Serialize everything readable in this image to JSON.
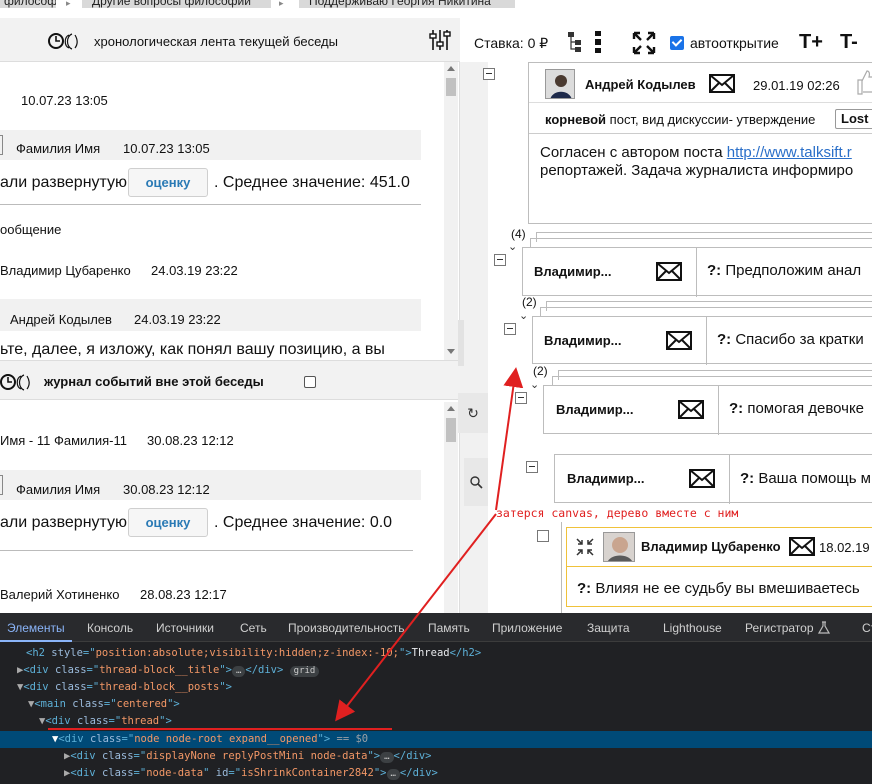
{
  "top_tabs": [
    "философии",
    "Другие вопросы философии",
    "Поддерживаю Георгия Никитина"
  ],
  "left": {
    "header_title": "хронологическая лента текущей беседы",
    "feed1": [
      {
        "date": "10.07.23 13:05"
      },
      {
        "author": "Фамилия Имя",
        "date": "10.07.23 13:05"
      },
      {
        "text_before": "али развернутую",
        "button": "оценку",
        "text_after": ". Среднее значение: 451.0"
      },
      {
        "text": "ообщение"
      },
      {
        "author": "Владимир Цубаренко",
        "date": "24.03.19 23:22"
      },
      {
        "author": "Андрей Кодылев",
        "date": "24.03.19 23:22"
      },
      {
        "text": "ьте, далее, я изложу, как понял вашу позицию, а вы"
      }
    ],
    "journal_title": "журнал событий вне этой беседы",
    "journal_checked": false,
    "feed2": [
      {
        "author": "Имя - 11 Фамилия-11",
        "date": "30.08.23 12:12"
      },
      {
        "author": "Фамилия Имя",
        "date": "30.08.23 12:12"
      },
      {
        "text_before": "али развернутую",
        "button": "оценку",
        "text_after": ". Среднее значение: 0.0"
      },
      {
        "author": "Валерий Хотиненко",
        "date": "28.08.23 12:17"
      }
    ]
  },
  "toolbar": {
    "stake": "Ставка: 0 ₽",
    "autoopen_label": "автооткрытие",
    "autoopen_checked": true,
    "font_plus": "T+",
    "font_minus": "T-"
  },
  "tree": {
    "root": {
      "author": "Андрей Кодылев",
      "date": "29.01.19 02:26",
      "meta_bold": "корневой",
      "meta_rest": " пост, вид дискуссии- утверждение",
      "tag": "Lost",
      "body_line1_prefix": "Согласен с автором поста ",
      "body_link": "http://www.talksift.r",
      "body_line2": "репортажей. Задача журналиста информиро"
    },
    "nodes": [
      {
        "count": "(4)",
        "author": "Владимир...",
        "prefix": "?:",
        "text": " Предположим анал"
      },
      {
        "count": "(2)",
        "author": "Владимир...",
        "prefix": "?:",
        "text": " Спасибо за кратки"
      },
      {
        "count": "(2)",
        "author": "Владимир...",
        "prefix": "?:",
        "text": " помогая девочке"
      },
      {
        "count": "",
        "author": "Владимир...",
        "prefix": "?:",
        "text": " Ваша помощь м"
      }
    ],
    "leaf": {
      "author": "Владимир Цубаренко",
      "date": "18.02.19",
      "prefix": "?:",
      "text": " Влияя не ее судьбу вы вмешиваетесь"
    }
  },
  "annotation": "затерся canvas, дерево вместе с ним",
  "devtools": {
    "tabs": [
      "Элементы",
      "Консоль",
      "Источники",
      "Сеть",
      "Производительность",
      "Память",
      "Приложение",
      "Защита",
      "Lighthouse",
      "Регистратор",
      "Ст"
    ],
    "active_tab": "Элементы",
    "lines": {
      "l1_style": "position:absolute;visibility:hidden;z-index:-10;",
      "l1_text": "Thread",
      "l2_class": "thread-block__title",
      "l2_pill": "grid",
      "l3_class": "thread-block__posts",
      "l4_class": "centered",
      "l5_class": "thread",
      "l6_class": "node node-root expand__opened",
      "l6_eq": "== $0",
      "l7_class": "displayNone replyPostMini node-data",
      "l8_class": "node-data",
      "l8_id": "isShrinkContainer2842"
    }
  },
  "colors": {
    "link": "#2a6fc9",
    "rate_button_text": "#2a7ab5",
    "annotation": "#e02020",
    "devtools_bg": "#202124",
    "selected_row": "#004a77"
  }
}
